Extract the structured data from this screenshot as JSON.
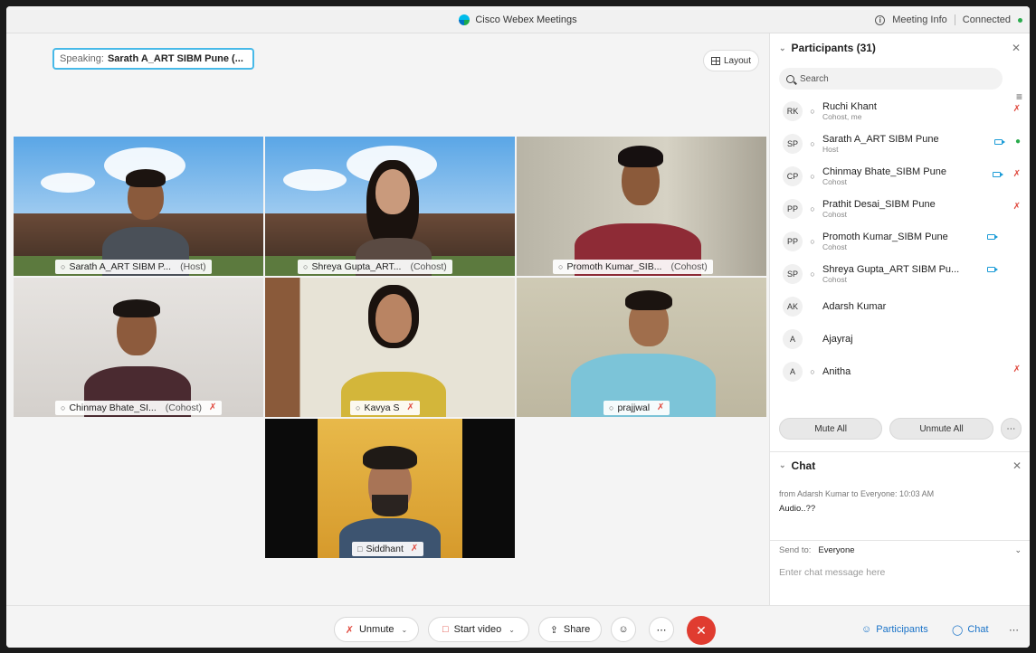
{
  "window": {
    "title": "Cisco Webex Meetings",
    "meeting_info": "Meeting Info",
    "status": "Connected"
  },
  "stage": {
    "speaking_prefix": "Speaking:",
    "speaking_name": "Sarath A_ART SIBM Pune (...",
    "layout_label": "Layout"
  },
  "tiles": [
    {
      "name": "Sarath A_ART SIBM P...",
      "role": "(Host)"
    },
    {
      "name": "Shreya Gupta_ART...",
      "role": "(Cohost)"
    },
    {
      "name": "Promoth Kumar_SIB...",
      "role": "(Cohost)"
    },
    {
      "name": "Chinmay Bhate_SI...",
      "role": "(Cohost)"
    },
    {
      "name": "Kavya S",
      "role": ""
    },
    {
      "name": "prajjwal",
      "role": ""
    },
    {
      "name": "Siddhant",
      "role": ""
    }
  ],
  "participants": {
    "title": "Participants (31)",
    "search_placeholder": "Search",
    "list": [
      {
        "initials": "RK",
        "name": "Ruchi Khant",
        "role": "Cohost, me",
        "video": false,
        "mic": "muted"
      },
      {
        "initials": "SP",
        "name": "Sarath A_ART SIBM Pune",
        "role": "Host",
        "video": true,
        "mic": "active"
      },
      {
        "initials": "CP",
        "name": "Chinmay Bhate_SIBM Pune",
        "role": "Cohost",
        "video": true,
        "mic": "muted"
      },
      {
        "initials": "PP",
        "name": "Prathit Desai_SIBM Pune",
        "role": "Cohost",
        "video": false,
        "mic": "muted"
      },
      {
        "initials": "PP",
        "name": "Promoth Kumar_SIBM Pune",
        "role": "Cohost",
        "video": true,
        "mic": "none"
      },
      {
        "initials": "SP",
        "name": "Shreya Gupta_ART SIBM Pu...",
        "role": "Cohost",
        "video": true,
        "mic": "none"
      },
      {
        "initials": "AK",
        "name": "Adarsh Kumar",
        "role": "",
        "video": false,
        "mic": "none"
      },
      {
        "initials": "A",
        "name": "Ajayraj",
        "role": "",
        "video": false,
        "mic": "none"
      },
      {
        "initials": "A",
        "name": "Anitha",
        "role": "",
        "video": false,
        "mic": "muted"
      }
    ],
    "mute_all": "Mute All",
    "unmute_all": "Unmute All"
  },
  "chat": {
    "title": "Chat",
    "meta": "from Adarsh Kumar to Everyone:   10:03  AM",
    "message": "Audio..??",
    "send_to_label": "Send to:",
    "send_to_value": "Everyone",
    "input_placeholder": "Enter chat message here"
  },
  "controls": {
    "unmute": "Unmute",
    "start_video": "Start video",
    "share": "Share",
    "participants": "Participants",
    "chat": "Chat"
  },
  "colors": {
    "accent": "#47b9e8",
    "end_call": "#e03c30",
    "muted": "#e04a3f",
    "active": "#2aab4c",
    "link": "#1a73c8"
  }
}
